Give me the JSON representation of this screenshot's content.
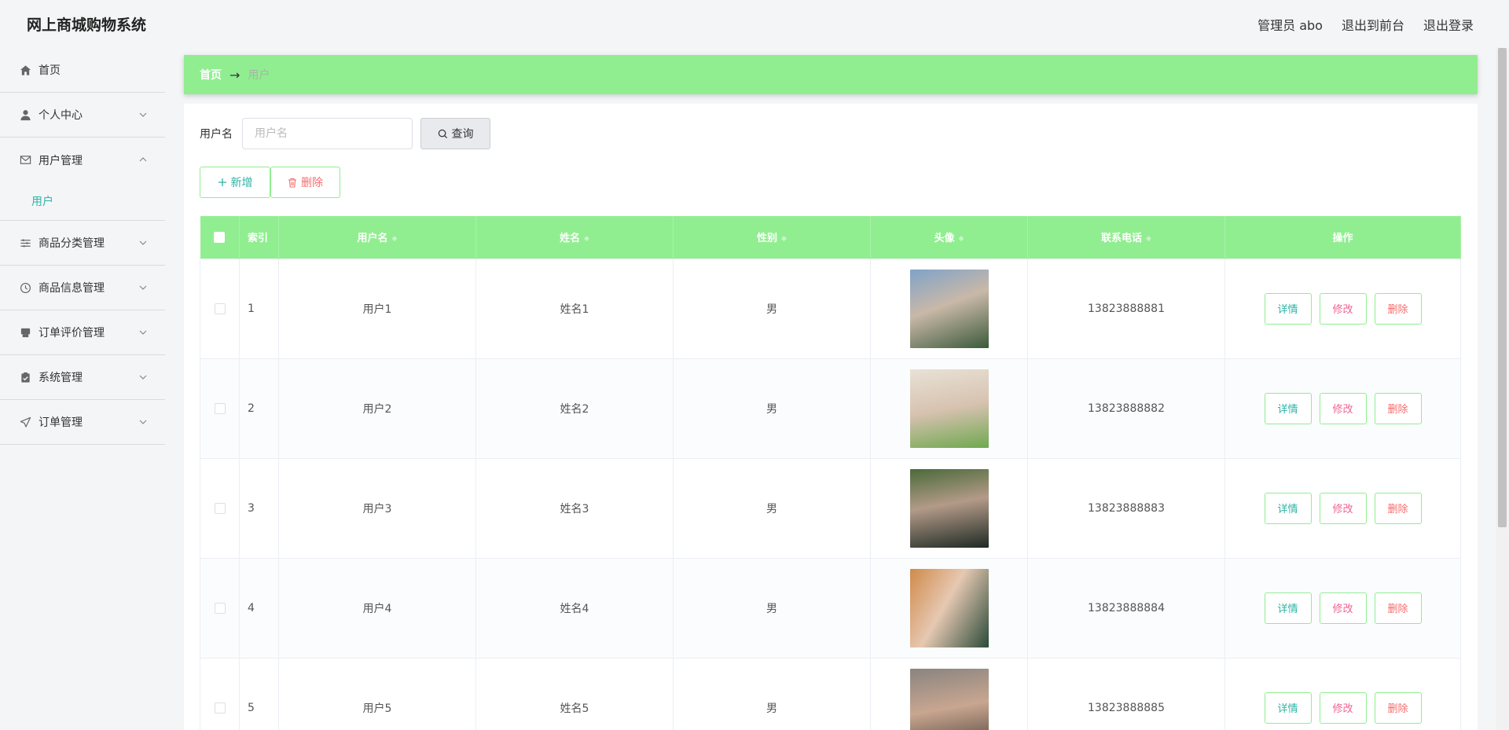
{
  "app": {
    "title": "网上商城购物系统"
  },
  "header": {
    "admin": "管理员 abo",
    "to_front": "退出到前台",
    "logout": "退出登录"
  },
  "sidebar": {
    "items": [
      {
        "label": "首页",
        "icon": "home-icon"
      },
      {
        "label": "个人中心",
        "icon": "user-icon"
      },
      {
        "label": "用户管理",
        "icon": "mail-icon",
        "sub": "用户"
      },
      {
        "label": "商品分类管理",
        "icon": "list-icon"
      },
      {
        "label": "商品信息管理",
        "icon": "clock-icon"
      },
      {
        "label": "订单评价管理",
        "icon": "printer-icon"
      },
      {
        "label": "系统管理",
        "icon": "clipboard-icon"
      },
      {
        "label": "订单管理",
        "icon": "send-icon"
      }
    ]
  },
  "breadcrumb": {
    "home": "首页",
    "sep": "→",
    "current": "用户"
  },
  "search": {
    "label": "用户名",
    "placeholder": "用户名",
    "value": "",
    "button": "查询"
  },
  "actions": {
    "add": "新增",
    "delete": "删除"
  },
  "table": {
    "headers": [
      "索引",
      "用户名",
      "姓名",
      "性别",
      "头像",
      "联系电话",
      "操作"
    ],
    "ops": {
      "detail": "详情",
      "edit": "修改",
      "delete": "删除"
    },
    "rows": [
      {
        "index": "1",
        "username": "用户1",
        "name": "姓名1",
        "gender": "男",
        "phone": "13823888881"
      },
      {
        "index": "2",
        "username": "用户2",
        "name": "姓名2",
        "gender": "男",
        "phone": "13823888882"
      },
      {
        "index": "3",
        "username": "用户3",
        "name": "姓名3",
        "gender": "男",
        "phone": "13823888883"
      },
      {
        "index": "4",
        "username": "用户4",
        "name": "姓名4",
        "gender": "男",
        "phone": "13823888884"
      },
      {
        "index": "5",
        "username": "用户5",
        "name": "姓名5",
        "gender": "男",
        "phone": "13823888885"
      }
    ]
  },
  "colors": {
    "accent": "#90ee90",
    "teal": "#2bb4a4",
    "danger": "#f56c6c",
    "pink": "#f06292"
  }
}
